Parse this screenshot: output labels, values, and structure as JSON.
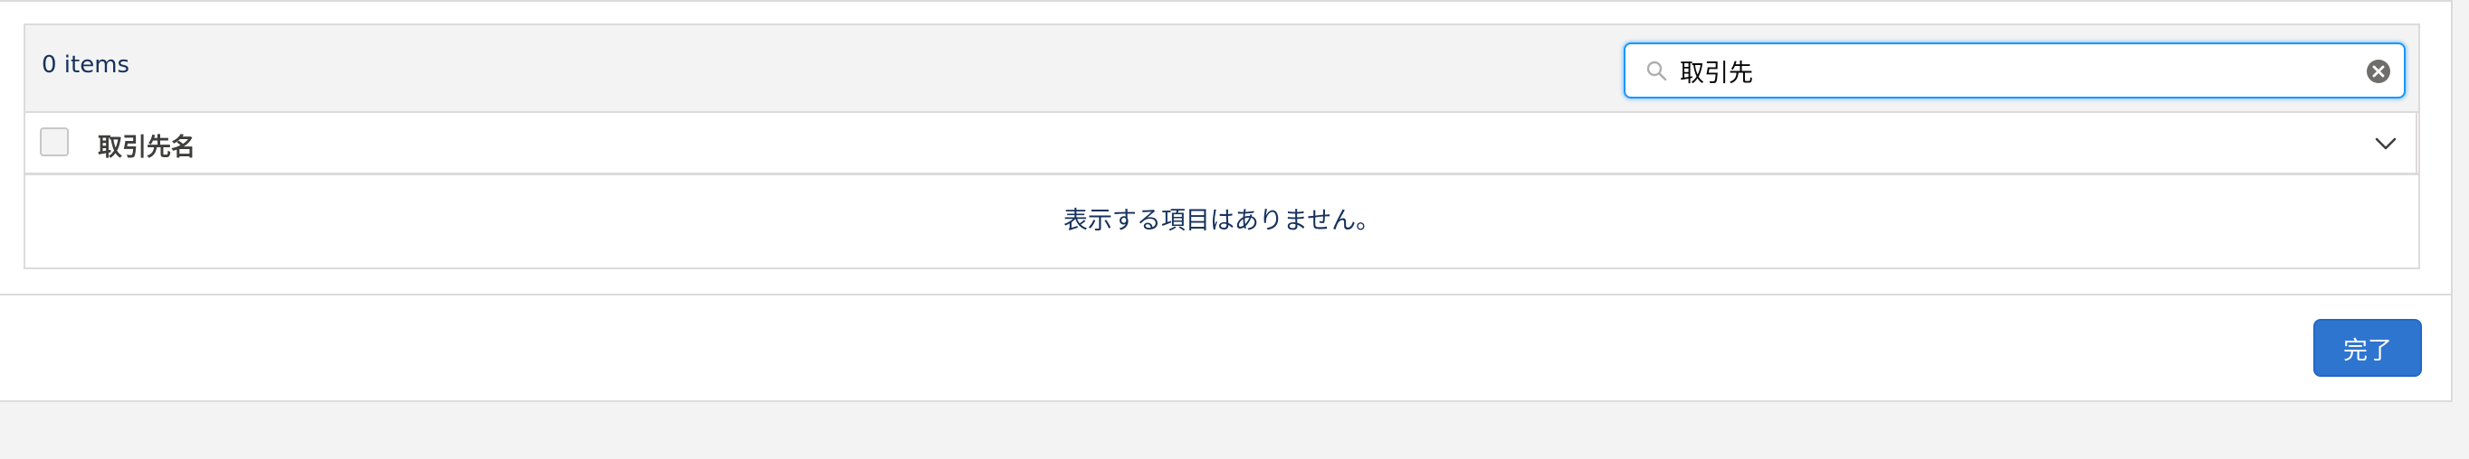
{
  "list": {
    "item_count": "0 items",
    "search": {
      "value": "取引先",
      "placeholder": ""
    },
    "columns": [
      {
        "label": "取引先名"
      }
    ],
    "empty_message": "表示する項目はありません。"
  },
  "footer": {
    "done_label": "完了"
  },
  "icons": {
    "search": "search-icon",
    "clear": "clear-icon",
    "column_menu": "chevron-down-icon"
  },
  "colors": {
    "accent": "#2e75d0",
    "focus_border": "#1b96ff",
    "text": "#16325c"
  }
}
